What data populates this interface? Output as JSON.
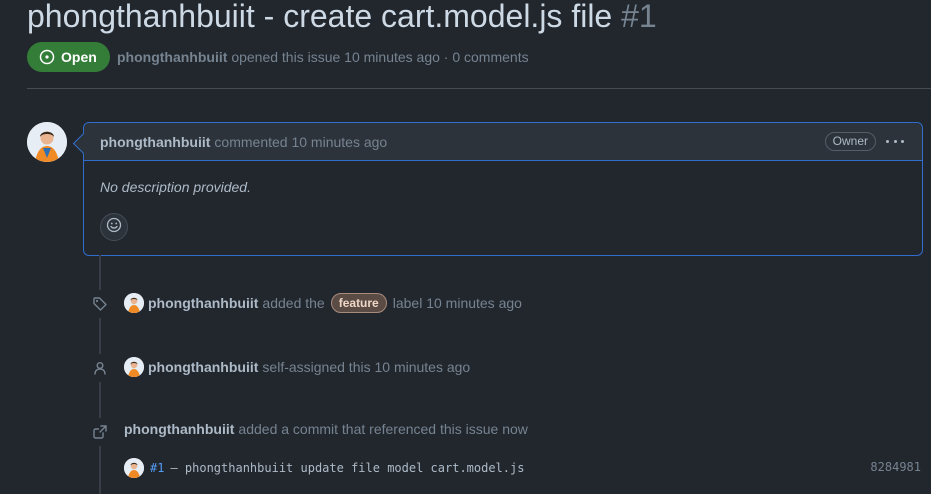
{
  "issue": {
    "title": "phongthanhbuiit - create cart.model.js file",
    "number": "#1",
    "state": "Open",
    "author": "phongthanhbuiit",
    "opened_text": "opened this issue 10 minutes ago · 0 comments"
  },
  "comment": {
    "author": "phongthanhbuiit",
    "action": "commented 10 minutes ago",
    "role_badge": "Owner",
    "body": "No description provided."
  },
  "timeline": {
    "label_event": {
      "author": "phongthanhbuiit",
      "prefix": "added the",
      "label": "feature",
      "suffix": "label 10 minutes ago"
    },
    "assign_event": {
      "author": "phongthanhbuiit",
      "text": "self-assigned this 10 minutes ago"
    },
    "commit_event": {
      "author": "phongthanhbuiit",
      "text": "added a commit that referenced this issue now",
      "commit_ref": "#1",
      "commit_message": "– phongthanhbuiit update file model cart.model.js",
      "commit_sha": "8284981"
    }
  },
  "colors": {
    "background": "#22272e",
    "open_badge": "#347d39",
    "accent_border": "#316dca",
    "label_feature": "#5a4c45"
  }
}
